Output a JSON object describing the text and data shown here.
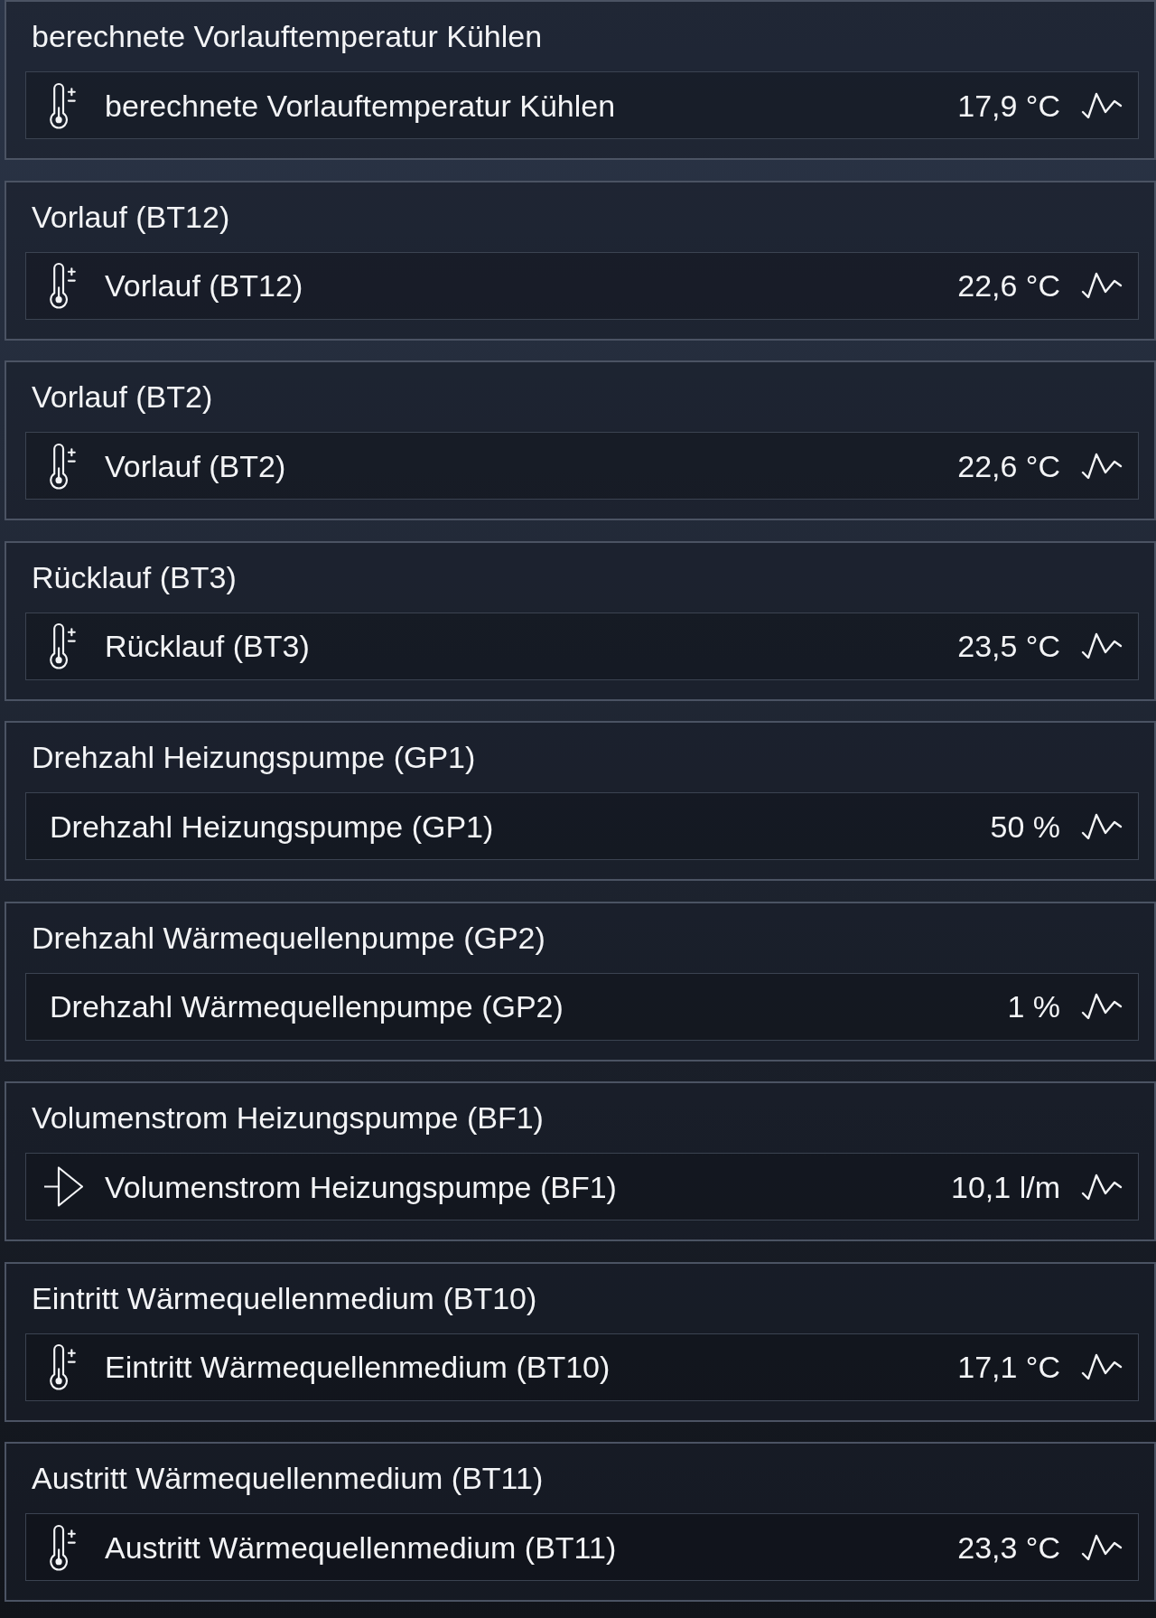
{
  "cards": [
    {
      "title": "berechnete Vorlauftemperatur Kühlen",
      "entity": {
        "kind": "temperature",
        "label": "berechnete Vorlauftemperatur Kühlen",
        "value": "17,9 °C"
      }
    },
    {
      "title": "Vorlauf (BT12)",
      "entity": {
        "kind": "temperature",
        "label": "Vorlauf (BT12)",
        "value": "22,6 °C"
      }
    },
    {
      "title": "Vorlauf (BT2)",
      "entity": {
        "kind": "temperature",
        "label": "Vorlauf (BT2)",
        "value": "22,6 °C"
      }
    },
    {
      "title": "Rücklauf (BT3)",
      "entity": {
        "kind": "temperature",
        "label": "Rücklauf (BT3)",
        "value": "23,5 °C"
      }
    },
    {
      "title": "Drehzahl Heizungspumpe (GP1)",
      "entity": {
        "kind": "speed",
        "label": "Drehzahl Heizungspumpe (GP1)",
        "value": "50 %"
      }
    },
    {
      "title": "Drehzahl Wärmequellenpumpe (GP2)",
      "entity": {
        "kind": "speed",
        "label": "Drehzahl Wärmequellenpumpe (GP2)",
        "value": "1 %"
      }
    },
    {
      "title": "Volumenstrom Heizungspumpe (BF1)",
      "entity": {
        "kind": "flow",
        "label": "Volumenstrom Heizungspumpe (BF1)",
        "value": "10,1 l/m"
      }
    },
    {
      "title": "Eintritt Wärmequellenmedium (BT10)",
      "entity": {
        "kind": "temperature",
        "label": "Eintritt Wärmequellenmedium (BT10)",
        "value": "17,1 °C"
      }
    },
    {
      "title": "Austritt Wärmequellenmedium (BT11)",
      "entity": {
        "kind": "temperature",
        "label": "Austritt Wärmequellenmedium (BT11)",
        "value": "23,3 °C"
      }
    }
  ]
}
